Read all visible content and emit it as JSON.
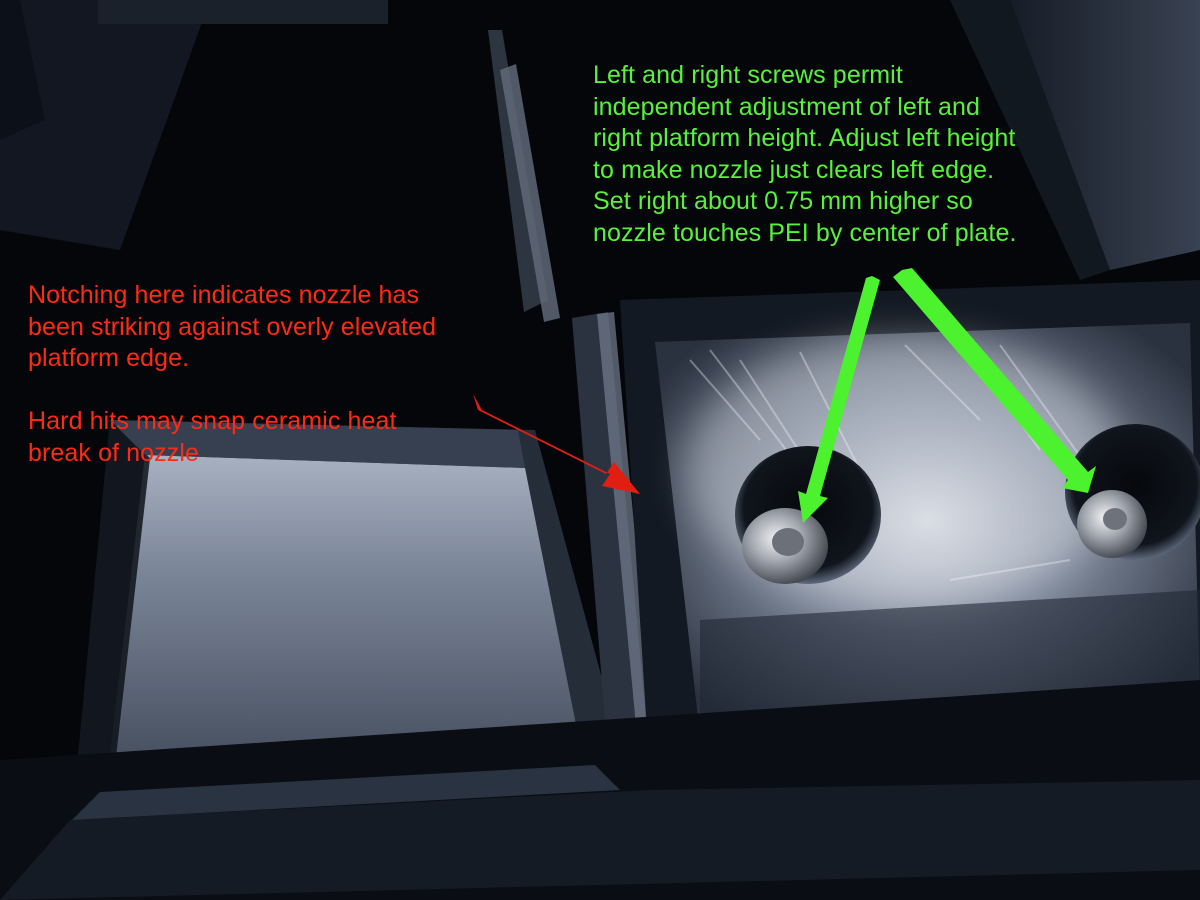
{
  "annotations": {
    "red": {
      "color": "#ff2a16",
      "paragraph_1_lines": [
        "Notching here indicates nozzle has",
        "been striking against overly elevated",
        "platform edge."
      ],
      "paragraph_2_lines": [
        "Hard hits may snap ceramic heat",
        "break of nozzle"
      ]
    },
    "green": {
      "color": "#58f23a",
      "lines": [
        "Left and right screws permit",
        "independent adjustment of left and",
        "right platform height. Adjust left height",
        "to make nozzle just clears left edge.",
        "Set right about 0.75 mm higher so",
        "nozzle touches PEI by center of plate."
      ]
    }
  },
  "arrows": {
    "notch_arrow_color": "#e01e12",
    "screw_arrow_color": "#4cf22e"
  }
}
